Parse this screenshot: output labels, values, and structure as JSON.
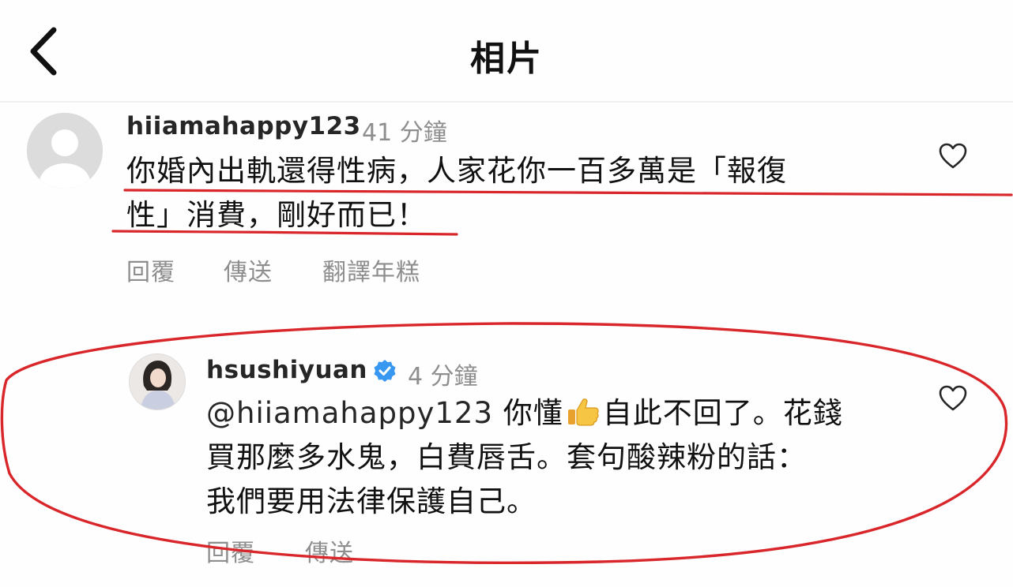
{
  "header": {
    "title": "相片"
  },
  "comments": [
    {
      "username": "hiiamahappy123",
      "time": "41 分鐘",
      "text_line1": "你婚內出軌還得性病，人家花你一百多萬是「報復",
      "text_line2": "性」消費，剛好而已！",
      "actions": {
        "reply": "回覆",
        "send": "傳送",
        "translate": "翻譯年糕"
      }
    },
    {
      "username": "hsushiyuan",
      "verified": true,
      "time": "4 分鐘",
      "mention": "@hiiamahappy123",
      "text_part1": " 你懂",
      "text_part2": "自此不回了。花錢",
      "text_line2": "買那麼多水鬼，白費唇舌。套句酸辣粉的話：",
      "text_line3": "我們要用法律保護自己。",
      "actions": {
        "reply": "回覆",
        "send": "傳送"
      }
    }
  ],
  "colors": {
    "annotation_red": "#d8262a",
    "verified_blue": "#3897f0",
    "muted_text": "#8e8e8e"
  },
  "icons": {
    "back": "chevron-left-icon",
    "like": "heart-outline-icon",
    "verified": "verified-badge-icon",
    "emoji": "thumbs-up-emoji"
  }
}
